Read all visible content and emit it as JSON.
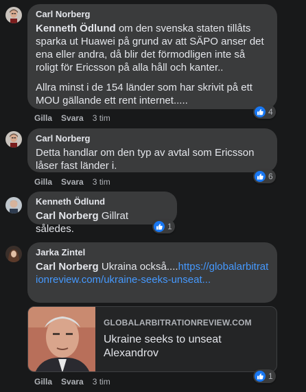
{
  "colors": {
    "background": "#18191a",
    "bubble": "#3a3b3c",
    "link": "#4599ff",
    "like_blue": "#1877f2"
  },
  "actions": {
    "like_label": "Gilla",
    "reply_label": "Svara"
  },
  "comments": [
    {
      "author": "Carl Norberg",
      "mention": "Kenneth Ödlund",
      "text_after_mention": " om den svenska staten tillåts sparka ut Huawei på grund av att SÄPO anser det ena eller andra, då blir det förmodligen inte så roligt för Ericsson på alla håll och kanter..",
      "paragraph2": "Allra minst i de 154 länder som har skrivit på ett MOU gällande ett rent internet.....",
      "time": "3 tim",
      "reaction_icon": "like-icon",
      "reaction_count": "4"
    },
    {
      "author": "Carl Norberg",
      "text": "Detta handlar om den typ av avtal som Ericsson låser fast länder i.",
      "time": "3 tim",
      "reaction_icon": "like-icon",
      "reaction_count": "6"
    },
    {
      "author": "Kenneth Ödlund",
      "mention": "Carl Norberg",
      "text_after_mention": " Gillrat således.",
      "time": "",
      "reaction_icon": "like-icon",
      "reaction_count": "1"
    },
    {
      "author": "Jarka Zintel",
      "mention": "Carl Norberg",
      "text_after_mention": " Ukraina också....",
      "link_text": "https://globalarbitrationreview.com/ukraine-seeks-unseat...",
      "time": "3 tim",
      "reaction_icon": "like-icon",
      "reaction_count": "1",
      "link_preview": {
        "domain": "GLOBALARBITRATIONREVIEW.COM",
        "title": "Ukraine seeks to unseat Alexandrov"
      }
    }
  ]
}
